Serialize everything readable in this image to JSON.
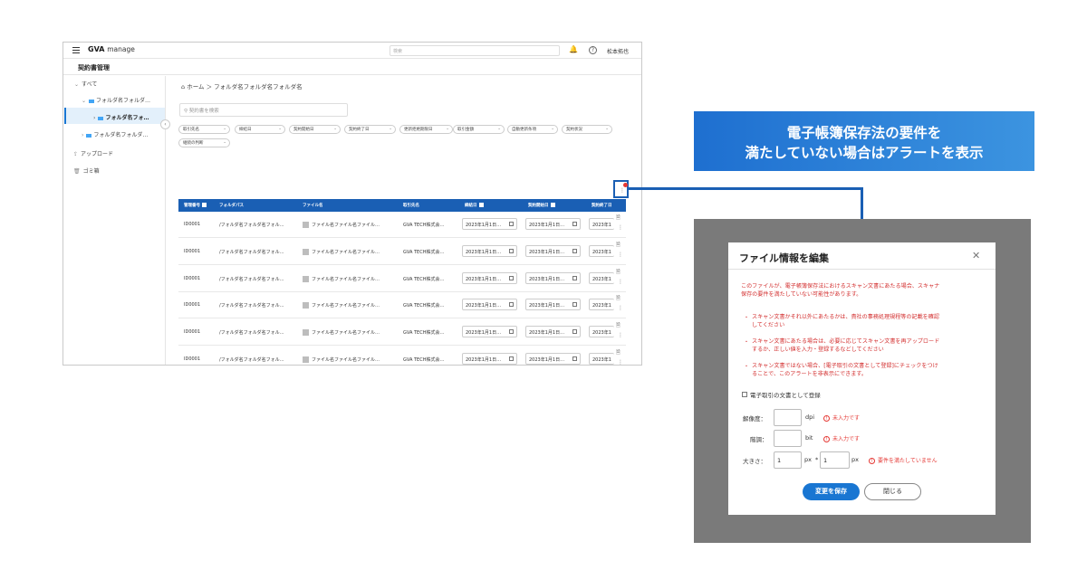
{
  "app": {
    "logo": "GVA",
    "logo_suffix": "manage",
    "search_placeholder": "検索",
    "user_name": "松本拓也",
    "page_heading": "契約書管理"
  },
  "sidebar": {
    "items": [
      {
        "label": "すべて"
      },
      {
        "label": "フォルダ名フォルダ…"
      },
      {
        "label": "フォルダ名フォ…"
      },
      {
        "label": "フォルダ名フォルダ…"
      },
      {
        "label": "アップロード"
      },
      {
        "label": "ゴミ箱"
      }
    ]
  },
  "main": {
    "breadcrumb": "ホーム ＞ フォルダ名フォルダ名フォルダ名",
    "search_placeholder": "契約書を検索",
    "filters": [
      "取引先名",
      "締結日",
      "契約開始日",
      "契約終了日",
      "更新拒絶期限日",
      "取引金額",
      "自動更新条項",
      "契約状況",
      "継続の判断"
    ],
    "columns": [
      "管理番号",
      "フォルダパス",
      "ファイル名",
      "取引先名",
      "締結日",
      "契約開始日",
      "契約終了日"
    ],
    "rows": [
      [
        "ID0001",
        "/フォルダ名フォルダ名フォル…",
        "ファイル名ファイル名ファイル…",
        "GVA TECH株式会…",
        "2023年1月1日…",
        "2023年1月1日…",
        "2023年1"
      ],
      [
        "ID0001",
        "/フォルダ名フォルダ名フォル…",
        "ファイル名ファイル名ファイル…",
        "GVA TECH株式会…",
        "2023年1月1日…",
        "2023年1月1日…",
        "2023年1"
      ],
      [
        "ID0001",
        "/フォルダ名フォルダ名フォル…",
        "ファイル名ファイル名ファイル…",
        "GVA TECH株式会…",
        "2023年1月1日…",
        "2023年1月1日…",
        "2023年1"
      ],
      [
        "ID0001",
        "/フォルダ名フォルダ名フォル…",
        "ファイル名ファイル名ファイル…",
        "GVA TECH株式会…",
        "2023年1月1日…",
        "2023年1月1日…",
        "2023年1"
      ],
      [
        "ID0001",
        "/フォルダ名フォルダ名フォル…",
        "ファイル名ファイル名ファイル…",
        "GVA TECH株式会…",
        "2023年1月1日…",
        "2023年1月1日…",
        "2023年1"
      ],
      [
        "ID0001",
        "/フォルダ名フォルダ名フォル…",
        "ファイル名ファイル名ファイル…",
        "GVA TECH株式会…",
        "2023年1月1日…",
        "2023年1月1日…",
        "2023年1"
      ],
      [
        "ID0001",
        "/フォルダ名フォルダ名フォル…",
        "ファイル名ファイル名ファイル…",
        "GVA TECH株式会…",
        "2023年1月1日…",
        "2023年1月1日…",
        "2023年1"
      ]
    ]
  },
  "callout": {
    "line1": "電子帳簿保存法の要件を",
    "line2": "満たしていない場合はアラートを表示"
  },
  "dialog": {
    "title": "ファイル情報を編集",
    "warning_intro": [
      "このファイルが、電子帳簿保存法におけるスキャン文書にあたる場合、スキャナ",
      "保存の要件を満たしていない可能性があります。"
    ],
    "bullets": [
      [
        "スキャン文書かそれ以外にあたるかは、貴社の事務処理規程等の記載を確認",
        "してください"
      ],
      [
        "スキャン文書にあたる場合は、必要に応じてスキャン文書を再アップロード",
        "するか、正しい値を入力・登録するなどしてください"
      ],
      [
        "スキャン文書ではない場合、[電子取引の文書として登録]にチェックをつけ",
        "ることで、このアラートを非表示にできます。"
      ]
    ],
    "checkbox_label": "電子取引の文書として登録",
    "resolution_label": "解像度：",
    "resolution_unit": "dpi",
    "resolution_error": "未入力です",
    "gradation_label": "階調：",
    "gradation_unit": "bit",
    "gradation_error": "未入力です",
    "size_label": "大きさ：",
    "size_width": "1",
    "size_height": "1",
    "size_unit": "px",
    "size_times": "*",
    "size_error": "要件を満たしていません",
    "save_label": "変更を保存",
    "cancel_label": "閉じる"
  }
}
